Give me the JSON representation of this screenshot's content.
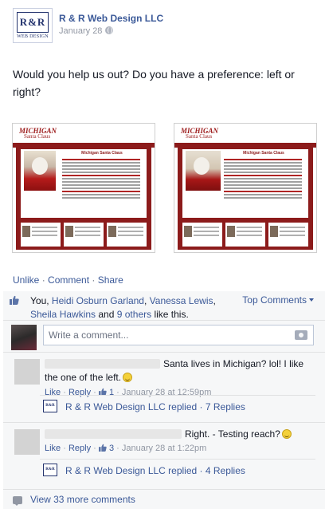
{
  "post": {
    "page_name": "R & R Web Design LLC",
    "date": "January 28",
    "privacy_icon": "globe-icon",
    "logo": {
      "top": "R&R",
      "bottom": "WEB DESIGN"
    },
    "text": "Would you help us out? Do you have a preference: left or right?"
  },
  "screenshots": {
    "left": {
      "logo": "MICHIGAN",
      "logo_sub": "Santa Claus",
      "heading": "Michigan Santa Claus"
    },
    "right": {
      "logo": "MICHIGAN",
      "logo_sub": "Santa Claus",
      "heading": "Michigan Santa Claus"
    }
  },
  "actions": {
    "unlike": "Unlike",
    "comment": "Comment",
    "share": "Share",
    "separator": " · "
  },
  "likes": {
    "prefix": "You, ",
    "names": [
      "Heidi Osburn Garland",
      "Vanessa Lewis",
      "Sheila Hawkins"
    ],
    "and": " and ",
    "others": "9 others",
    "suffix": " like this.",
    "top_comments": "Top Comments"
  },
  "composer": {
    "placeholder": "Write a comment..."
  },
  "comments": [
    {
      "text": "Santa lives in Michigan? lol! I like the one of the left.",
      "like": "Like",
      "reply": "Reply",
      "like_count": "1",
      "timestamp": "January 28 at 12:59pm",
      "reply_summary": "R & R Web Design LLC replied · 7 Replies"
    },
    {
      "text": "Right. - Testing reach?",
      "like": "Like",
      "reply": "Reply",
      "like_count": "3",
      "timestamp": "January 28 at 1:22pm",
      "reply_summary": "R & R Web Design LLC replied · 4 Replies"
    }
  ],
  "view_more": "View 33 more comments",
  "colors": {
    "link": "#3b5998",
    "ufi_bg": "#f6f7f8",
    "accent_red": "#8c1b1b"
  }
}
